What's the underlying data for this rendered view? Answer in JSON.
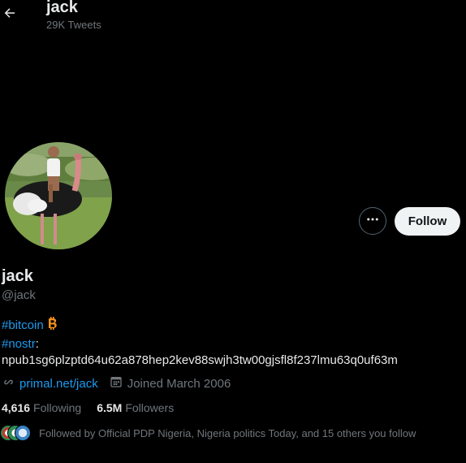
{
  "header": {
    "title": "jack",
    "tweet_count": "29K Tweets",
    "back_icon": "arrow-left-icon"
  },
  "profile": {
    "display_name": "jack",
    "handle": "@jack",
    "follow_label": "Follow",
    "more_icon": "more-horizontal-icon",
    "bio": {
      "hashtag_bitcoin": "#bitcoin",
      "bitcoin_icon": "bitcoin-icon",
      "hashtag_nostr": "#nostr",
      "nostr_suffix": ":",
      "npub": "npub1sg6plzptd64u62a878hep2kev88swjh3tw00gjsfl8f237lmu63q0uf63m"
    },
    "website": "primal.net/jack",
    "link_icon": "link-icon",
    "calendar_icon": "calendar-icon",
    "joined": "Joined March 2006",
    "stats": {
      "following_count": "4,616",
      "following_label": "Following",
      "followers_count": "6.5M",
      "followers_label": "Followers"
    },
    "followed_by": "Followed by Official PDP Nigeria, Nigeria politics Today, and 15 others you follow"
  },
  "colors": {
    "background": "#000000",
    "primary_text": "#e7e9ea",
    "secondary_text": "#71767b",
    "link": "#1d9bf0",
    "follow_button_bg": "#eff3f4",
    "bitcoin": "#f7931a"
  }
}
